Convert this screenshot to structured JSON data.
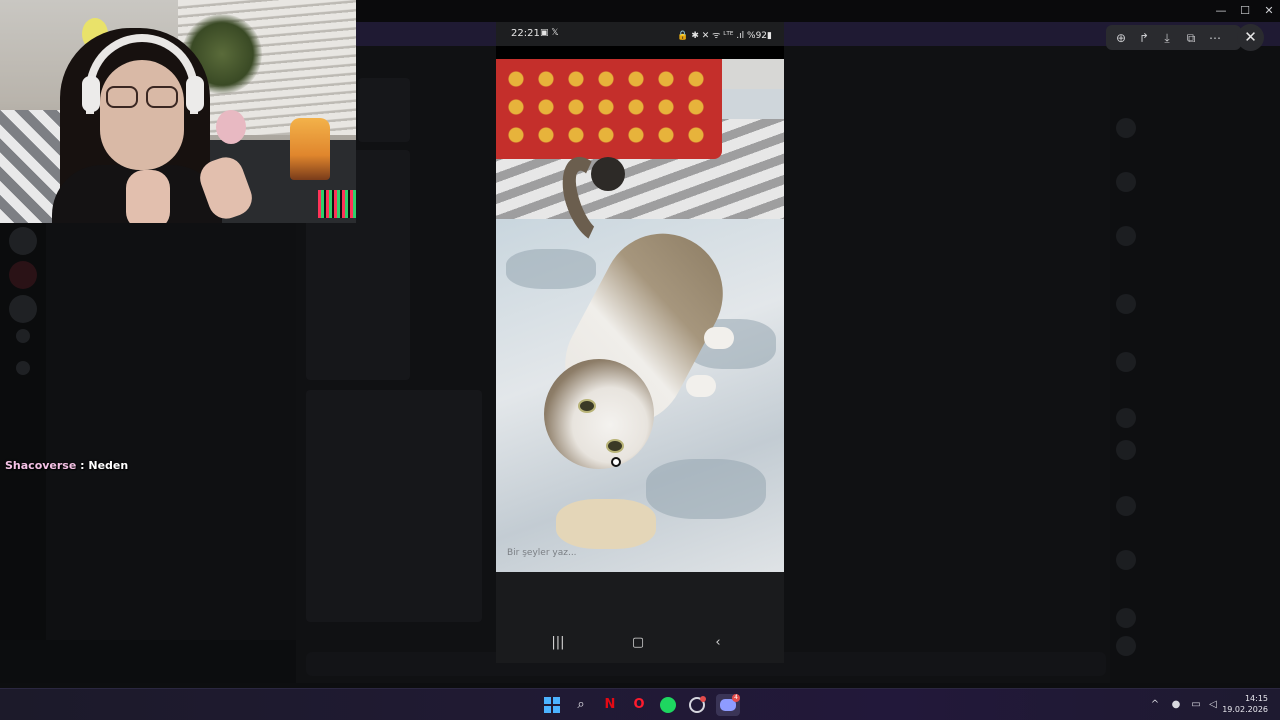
{
  "chat_overlay": {
    "user": "Shacoverse",
    "separator": " : ",
    "message": "Neden"
  },
  "phone": {
    "status_time": "22:21",
    "status_left_icons": "▣ 𝕏",
    "status_right": "🔒 ✱ ✕ ᯤ ᴸᵀᴱ .ıl %92▮",
    "caption_placeholder": "Bir şeyler yaz..."
  },
  "viewer_toolbar": {
    "zoom_icon": "⊕",
    "forward_icon": "↱",
    "download_icon": "⤓",
    "open_external_icon": "⧉",
    "more_icon": "⋯",
    "close_icon": "✕"
  },
  "window_controls": {
    "minimize": "—",
    "maximize": "☐",
    "close": "✕"
  },
  "taskbar": {
    "clock_time": "14:15",
    "clock_date": "19.02.2026",
    "apps": [
      "start",
      "search",
      "netflix",
      "opera",
      "spotify",
      "steam",
      "discord"
    ],
    "discord_badge": "4"
  },
  "colors": {
    "overlay_user": "#f4c2e5",
    "taskbar_bg": "#201a33",
    "viewer_bg": "#2a2b2f"
  }
}
